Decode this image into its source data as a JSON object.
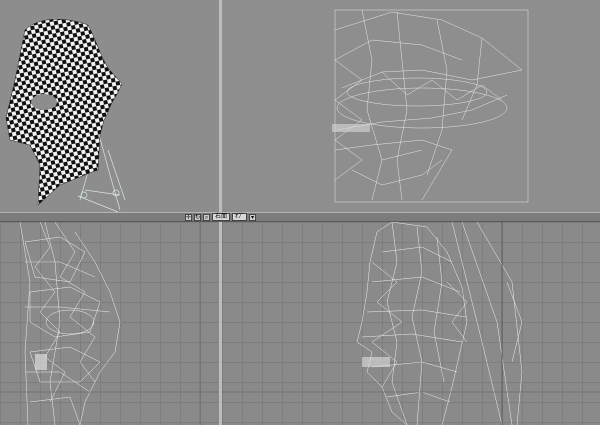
{
  "toolbar": {
    "move_icon": "move-icon",
    "rotate_icon": "rotate-icon",
    "zoom_icon": "zoom-icon",
    "view_label": "右面",
    "mode_label": "ｵﾌﾞ",
    "dropdown_icon": "chevron-down-icon"
  },
  "viewports": {
    "top_left": {
      "kind": "perspective-textured-head"
    },
    "top_right": {
      "kind": "uv-wireframe"
    },
    "bottom_left": {
      "kind": "side-wireframe-left"
    },
    "bottom_right": {
      "kind": "side-wireframe-right"
    }
  },
  "colors": {
    "wire": "#e8e8e8",
    "viewport_bg": "#8a8a8a",
    "grid": "#7d7d7d"
  }
}
